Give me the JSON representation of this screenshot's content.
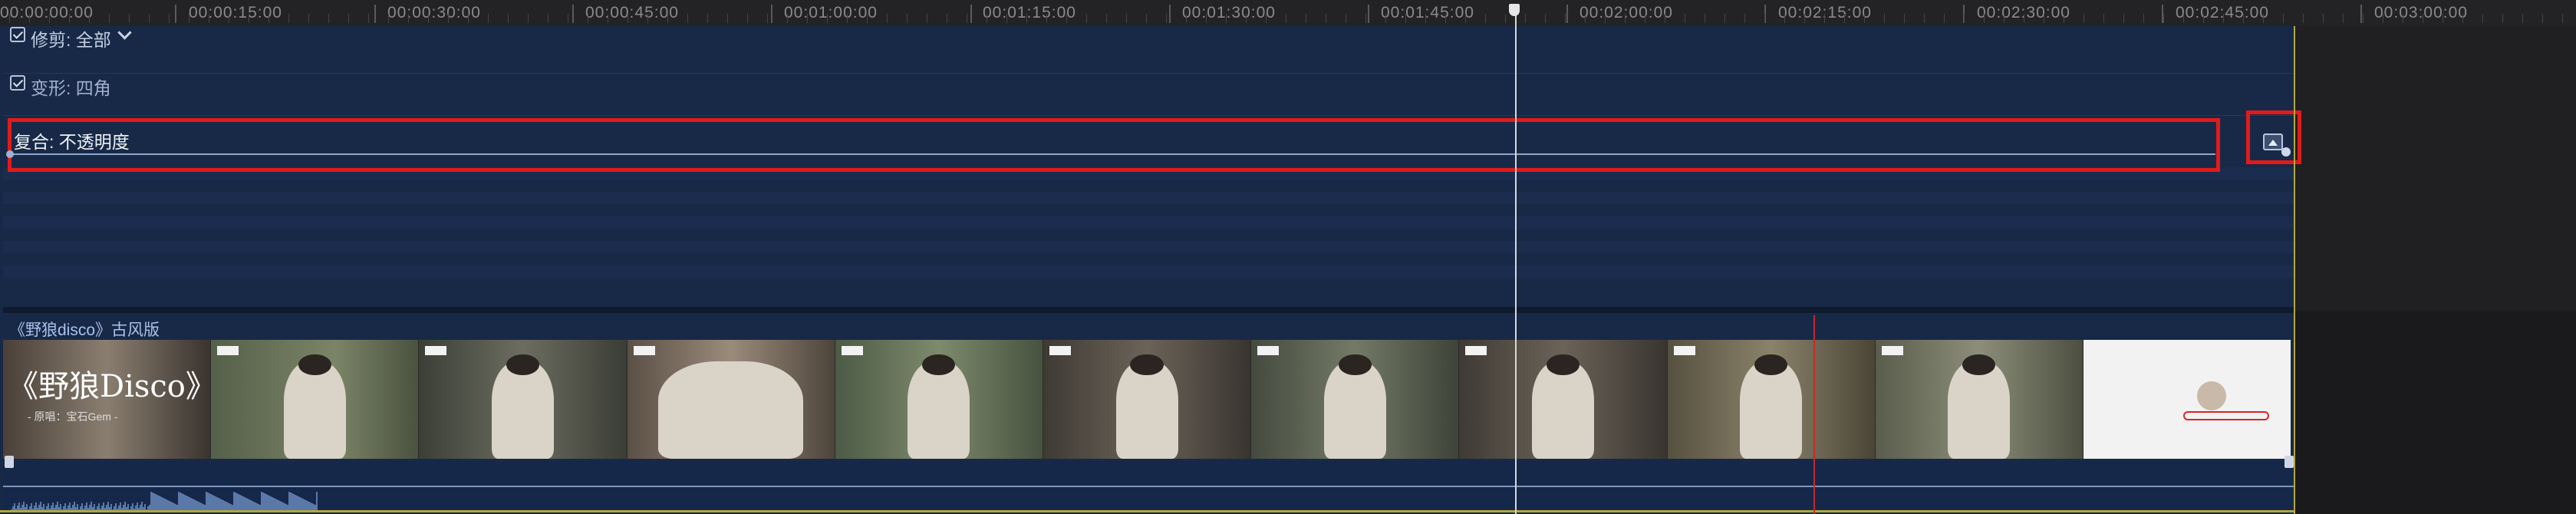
{
  "ruler": {
    "timecodes": [
      "00:00:00:00",
      "00:00:15:00",
      "00:00:30:00",
      "00:00:45:00",
      "00:01:00:00",
      "00:01:15:00",
      "00:01:30:00",
      "00:01:45:00",
      "00:02:00:00",
      "00:02:15:00",
      "00:02:30:00",
      "00:02:45:00",
      "00:03:00:00"
    ]
  },
  "effects": {
    "trim_label": "修剪: 全部",
    "transform_label": "变形: 四角",
    "composite_label": "复合: 不透明度"
  },
  "clip": {
    "title": "《野狼disco》古风版",
    "cover_title": "《野狼Disco》",
    "cover_subtitle": "- 原唱：宝石Gem -"
  },
  "colors": {
    "timeline_bg": "#182947",
    "highlight": "#e21a1a",
    "playhead": "#d8d8d8",
    "range_border": "#b3a73a",
    "marker": "#c42a2a"
  }
}
